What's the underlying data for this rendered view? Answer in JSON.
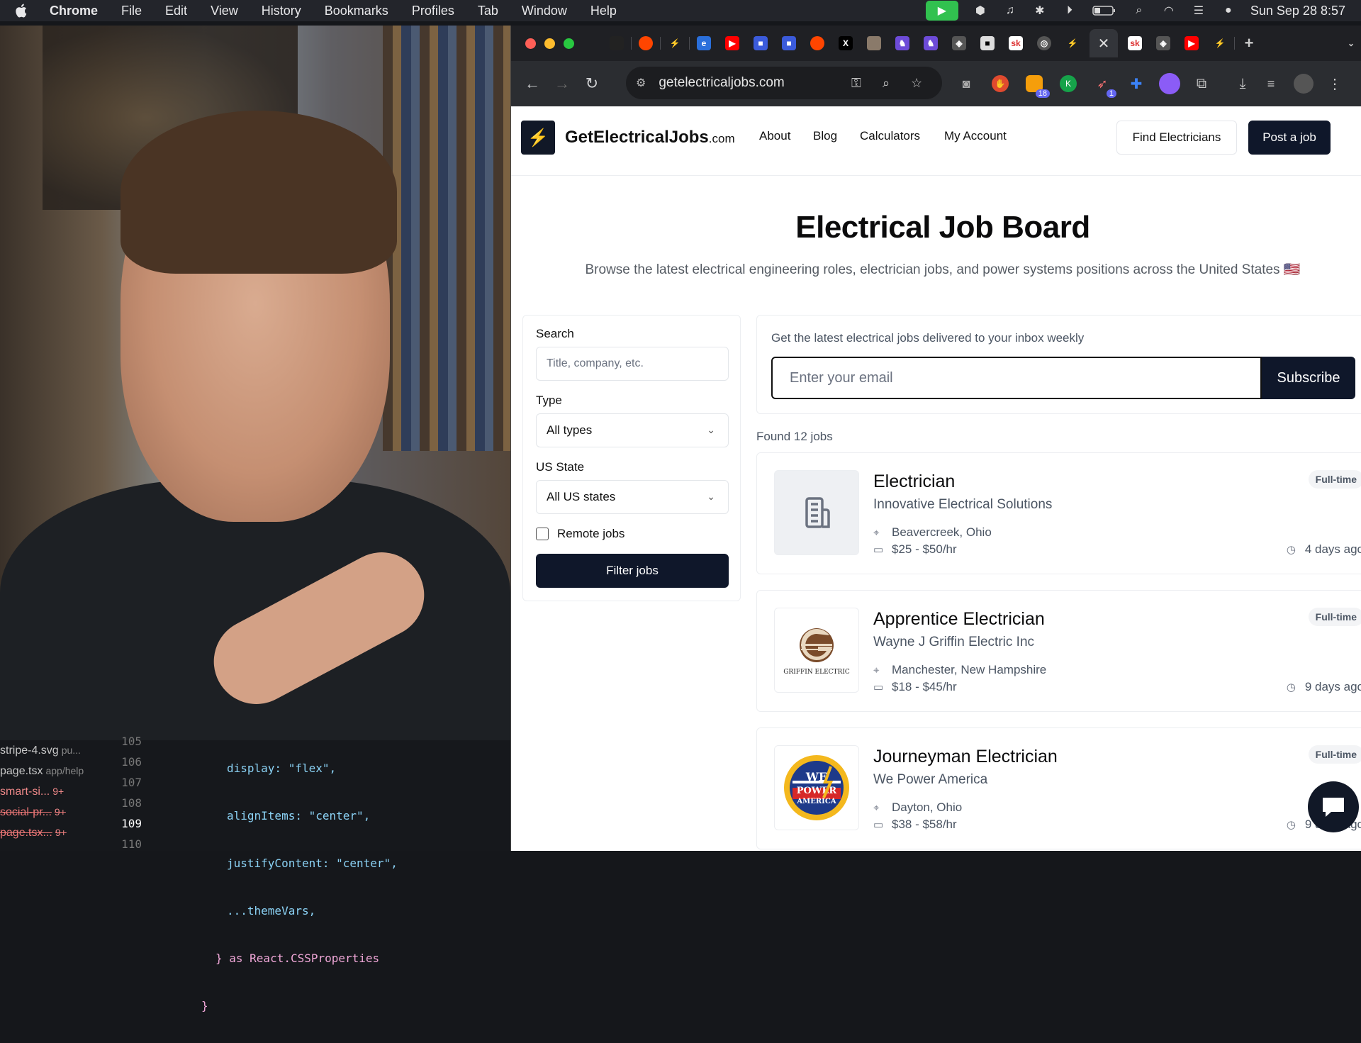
{
  "menubar": {
    "app": "Chrome",
    "items": [
      "File",
      "Edit",
      "View",
      "History",
      "Bookmarks",
      "Profiles",
      "Tab",
      "Window",
      "Help"
    ],
    "clock": "Sun Sep 28  8:57"
  },
  "editor": {
    "files": [
      {
        "name": "stripe-4.svg",
        "sub": "pu..."
      },
      {
        "name": "page.tsx",
        "sub": "app/help"
      },
      {
        "name": "smart-si...",
        "sub": "9+"
      },
      {
        "name": "social-pr...",
        "sub": "9+"
      },
      {
        "name": "page.tsx...",
        "sub": "9+"
      }
    ],
    "line_numbers": [
      "105",
      "106",
      "107",
      "108",
      "109",
      "110"
    ],
    "code_lines": [
      "display: \"flex\",",
      "alignItems: \"center\",",
      "justifyContent: \"center\",",
      "...themeVars,",
      "} as React.CSSProperties",
      "}"
    ]
  },
  "browser": {
    "url": "getelectricaljobs.com",
    "ext_badges": {
      "a": "18",
      "b": "1"
    }
  },
  "site": {
    "brand_main": "GetElectricalJobs",
    "brand_suffix": ".com",
    "nav": [
      "About",
      "Blog",
      "Calculators",
      "My Account"
    ],
    "find_label": "Find Electricians",
    "post_label": "Post a job",
    "title": "Electrical Job Board",
    "lede": "Browse the latest electrical engineering roles, electrician jobs, and power systems positions across the United States 🇺🇸"
  },
  "filters": {
    "search_label": "Search",
    "search_placeholder": "Title, company, etc.",
    "type_label": "Type",
    "type_value": "All types",
    "state_label": "US State",
    "state_value": "All US states",
    "remote_label": "Remote jobs",
    "button": "Filter jobs"
  },
  "newsletter": {
    "text": "Get the latest electrical jobs delivered to your inbox weekly",
    "placeholder": "Enter your email",
    "button": "Subscribe"
  },
  "found": "Found 12 jobs",
  "jobs": [
    {
      "title": "Electrician",
      "company": "Innovative Electrical Solutions",
      "location": "Beavercreek, Ohio",
      "pay": "$25 - $50/hr",
      "type": "Full-time",
      "age": "4 days ago"
    },
    {
      "title": "Apprentice Electrician",
      "company": "Wayne J Griffin Electric Inc",
      "location": "Manchester, New Hampshire",
      "pay": "$18 - $45/hr",
      "type": "Full-time",
      "age": "9 days ago"
    },
    {
      "title": "Journeyman Electrician",
      "company": "We Power America",
      "location": "Dayton, Ohio",
      "pay": "$38 - $58/hr",
      "type": "Full-time",
      "age": "9 days ago"
    }
  ],
  "logos": {
    "griffin_text": "GRIFFIN ELECTRIC",
    "wepower_line1": "WE",
    "wepower_line2": "POWER",
    "wepower_line3": "AMERICA"
  }
}
